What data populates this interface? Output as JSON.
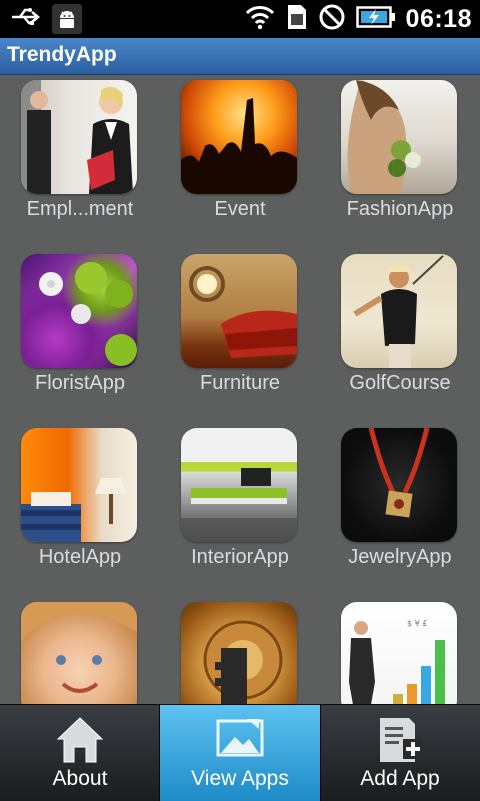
{
  "status_bar": {
    "time": "06:18",
    "icons": [
      "usb-icon",
      "android-debug-icon",
      "wifi-icon",
      "sim-icon",
      "no-signal-icon",
      "battery-charging-icon"
    ]
  },
  "app": {
    "title": "TrendyApp"
  },
  "grid": {
    "items": [
      {
        "label": "Empl...ment",
        "icon": "employment-thumbnail"
      },
      {
        "label": "Event",
        "icon": "event-thumbnail"
      },
      {
        "label": "FashionApp",
        "icon": "fashion-thumbnail"
      },
      {
        "label": "FloristApp",
        "icon": "florist-thumbnail"
      },
      {
        "label": "Furniture",
        "icon": "furniture-thumbnail"
      },
      {
        "label": "GolfCourse",
        "icon": "golf-thumbnail"
      },
      {
        "label": "HotelApp",
        "icon": "hotel-thumbnail"
      },
      {
        "label": "InteriorApp",
        "icon": "interior-thumbnail"
      },
      {
        "label": "JewelryApp",
        "icon": "jewelry-thumbnail"
      },
      {
        "label": "",
        "icon": "kid-thumbnail"
      },
      {
        "label": "",
        "icon": "key-thumbnail"
      },
      {
        "label": "",
        "icon": "business-thumbnail"
      }
    ]
  },
  "tabs": [
    {
      "label": "About",
      "icon": "house-icon",
      "active": false
    },
    {
      "label": "View Apps",
      "icon": "picture-icon",
      "active": true
    },
    {
      "label": "Add App",
      "icon": "add-document-icon",
      "active": false
    }
  ],
  "colors": {
    "background": "#5d5f5f",
    "title_bar": "#3a76b8",
    "active_tab": "#3fa9e0",
    "label_text": "#d6dcdf"
  }
}
